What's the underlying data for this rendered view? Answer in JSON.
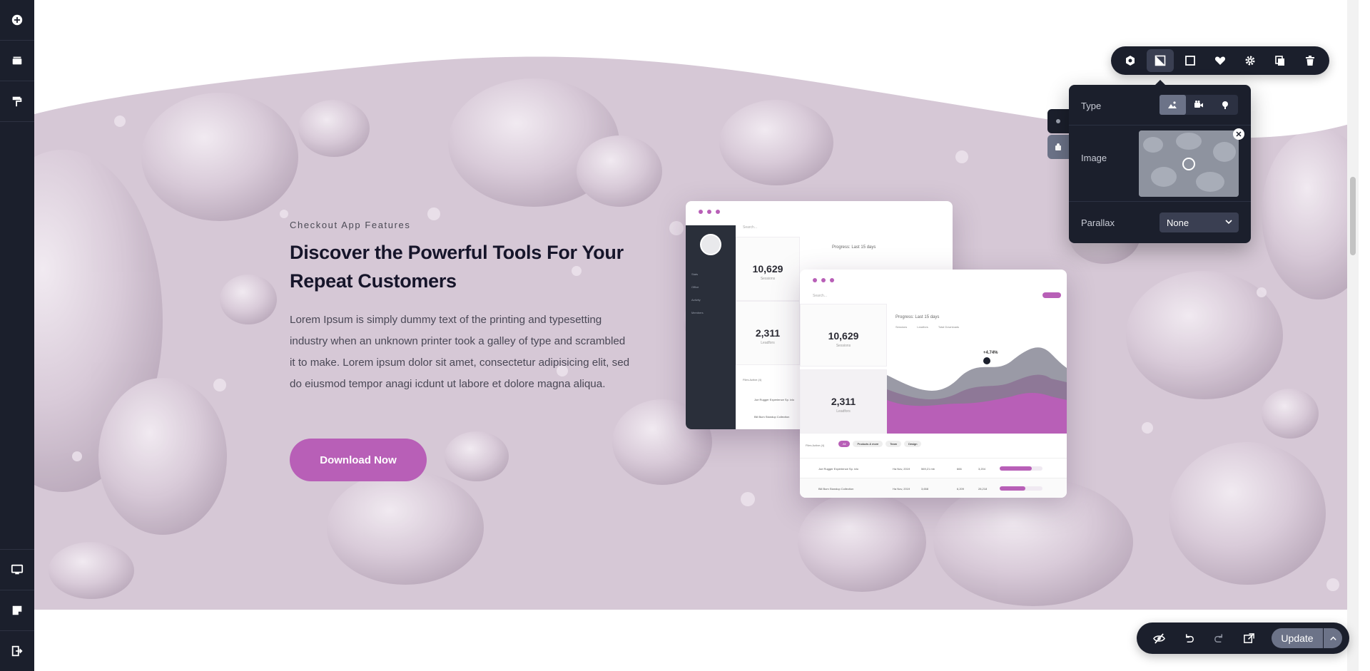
{
  "left_sidebar": {
    "top_icons": [
      "plus-circle-icon",
      "layers-icon",
      "paint-roller-icon"
    ],
    "bottom_icons": [
      "monitor-icon",
      "sticky-note-icon",
      "sign-out-icon"
    ]
  },
  "hero": {
    "eyebrow": "Checkout App Features",
    "headline": "Discover the Powerful Tools For Your Repeat Customers",
    "body": "Lorem Ipsum is simply dummy text of the printing and typesetting industry when an unknown printer took a galley of type and scrambled it to make. Lorem ipsum dolor sit amet, consectetur adipisicing elit, sed do eiusmod tempor anagi icdunt ut labore et dolore magna aliqua.",
    "cta_label": "Download Now",
    "accent_color": "#b85fb7"
  },
  "mock_back": {
    "search_placeholder": "Search...",
    "progress_label": "Progress: Last 15 days",
    "stats": [
      {
        "value": "10,629",
        "label": "Sessions"
      },
      {
        "value": "2,311",
        "label": "Leadfors"
      }
    ],
    "nav_items": [
      "Stats",
      "Office",
      "Activity",
      "Members"
    ],
    "files_label": "Files Active (4)",
    "rows": [
      "Joe Rugger Experience Sp. ivlo",
      "Bill Bum Standup Collection"
    ]
  },
  "mock_front": {
    "search_placeholder": "Search...",
    "progress_label": "Progress: Last 15 days",
    "legend": [
      "Sessions",
      "Leadfors",
      "Total Downloads"
    ],
    "stats": [
      {
        "value": "10,629",
        "label": "Sessions"
      },
      {
        "value": "2,311",
        "label": "Leadfors"
      }
    ],
    "chart_badge": "+4.74%",
    "files_label": "Files Active (4)",
    "filters": [
      "All",
      "Products & more",
      "Team",
      "Design"
    ],
    "rows": [
      {
        "name": "Joe Rugger Experience Sp. ivlo",
        "date": "Ha Nov, 2019",
        "size": "569,21 mb",
        "count": "666",
        "total": "3,204"
      },
      {
        "name": "Bill Bum Standup Collection",
        "date": "Ha Nov, 2019",
        "size": "3,658",
        "count": "6,209",
        "total": "28,218"
      }
    ]
  },
  "element_toolbar": {
    "buttons": [
      "hexagon-settings-icon",
      "background-icon",
      "border-icon",
      "heart-icon",
      "gear-icon",
      "duplicate-icon",
      "trash-icon"
    ],
    "active_index": 1
  },
  "background_popover": {
    "type_label": "Type",
    "type_options": [
      "image-icon",
      "video-icon",
      "color-dot-icon"
    ],
    "type_selected": "image",
    "image_label": "Image",
    "parallax_label": "Parallax",
    "parallax_value": "None"
  },
  "bottom_bar": {
    "icons": [
      "eye-slash-icon",
      "undo-icon",
      "redo-icon",
      "external-link-icon"
    ],
    "update_label": "Update"
  }
}
